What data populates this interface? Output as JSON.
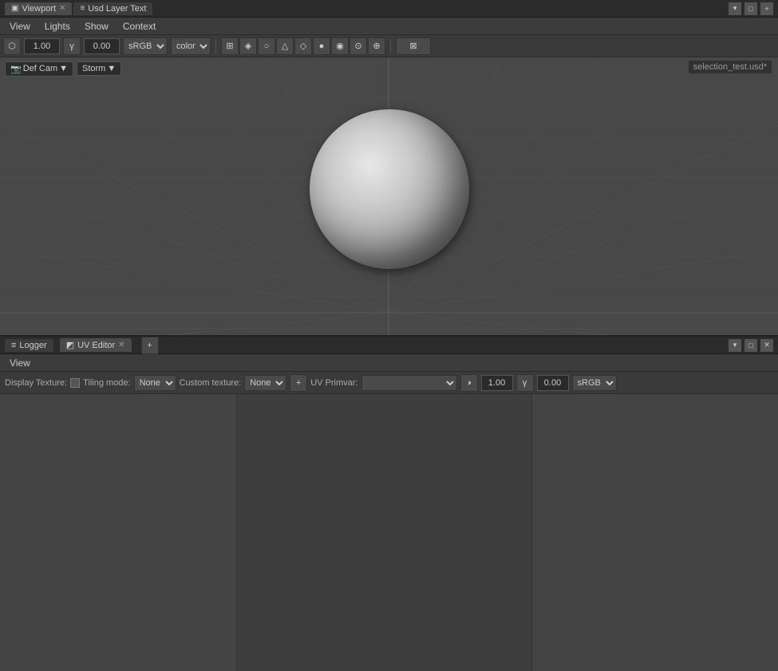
{
  "titleBar": {
    "tabs": [
      {
        "id": "viewport",
        "label": "Viewport",
        "icon": "▣",
        "active": true,
        "closable": true
      },
      {
        "id": "usd-layer-text",
        "label": "Usd Layer Text",
        "icon": "≡",
        "active": false,
        "closable": false
      }
    ],
    "controls": [
      "▾",
      "□",
      "+"
    ]
  },
  "viewport": {
    "menuBar": {
      "items": [
        "View",
        "Lights",
        "Show",
        "Context"
      ]
    },
    "toolbar": {
      "cameraIcon": "⬡",
      "exposureValue": "1.00",
      "gammaIcon": "γ",
      "gammaValue": "0.00",
      "colorspace": "sRGB",
      "displayMode": "color",
      "icons": [
        "⊞",
        "◈",
        "○",
        "△",
        "◇",
        "●",
        "◉",
        "⊙",
        "⊕",
        "⊠"
      ]
    },
    "cameraBar": {
      "cameraIcon": "📷",
      "cameraName": "Def Cam",
      "rendererIcon": "▼",
      "rendererName": "Storm",
      "rendererDropdown": "▼"
    },
    "scene": {
      "cameraLabel": "Def Cam",
      "fileLabel": "selection_test.usd*"
    }
  },
  "bottomPanel": {
    "titleBar": {
      "tabs": [
        {
          "id": "logger",
          "label": "Logger",
          "icon": "≡",
          "active": false,
          "closable": false
        },
        {
          "id": "uv-editor",
          "label": "UV Editor",
          "icon": "◩",
          "active": true,
          "closable": true
        }
      ],
      "addIcon": "+",
      "controls": [
        "▾",
        "□",
        "✕"
      ]
    },
    "viewMenuBar": {
      "items": [
        "View"
      ]
    },
    "uvToolbar": {
      "displayTextureLabel": "Display Texture:",
      "tilingModeLabel": "Tiling mode:",
      "tilingModeValue": "None",
      "customTextureLabel": "Custom texture:",
      "customTextureValue": "None",
      "addIcon": "+",
      "uvPrimvarLabel": "UV Primvar:",
      "exposureIcon": "◑",
      "exposureValue": "1.00",
      "gammaIcon": "γ",
      "gammaValue": "0.00",
      "colorspace": "sRGB"
    }
  },
  "colors": {
    "bg": "#3c3c3c",
    "titleBg": "#2b2b2b",
    "toolbarBg": "#3a3a3a",
    "border": "#2a2a2a",
    "accent": "#5a5a5a"
  }
}
